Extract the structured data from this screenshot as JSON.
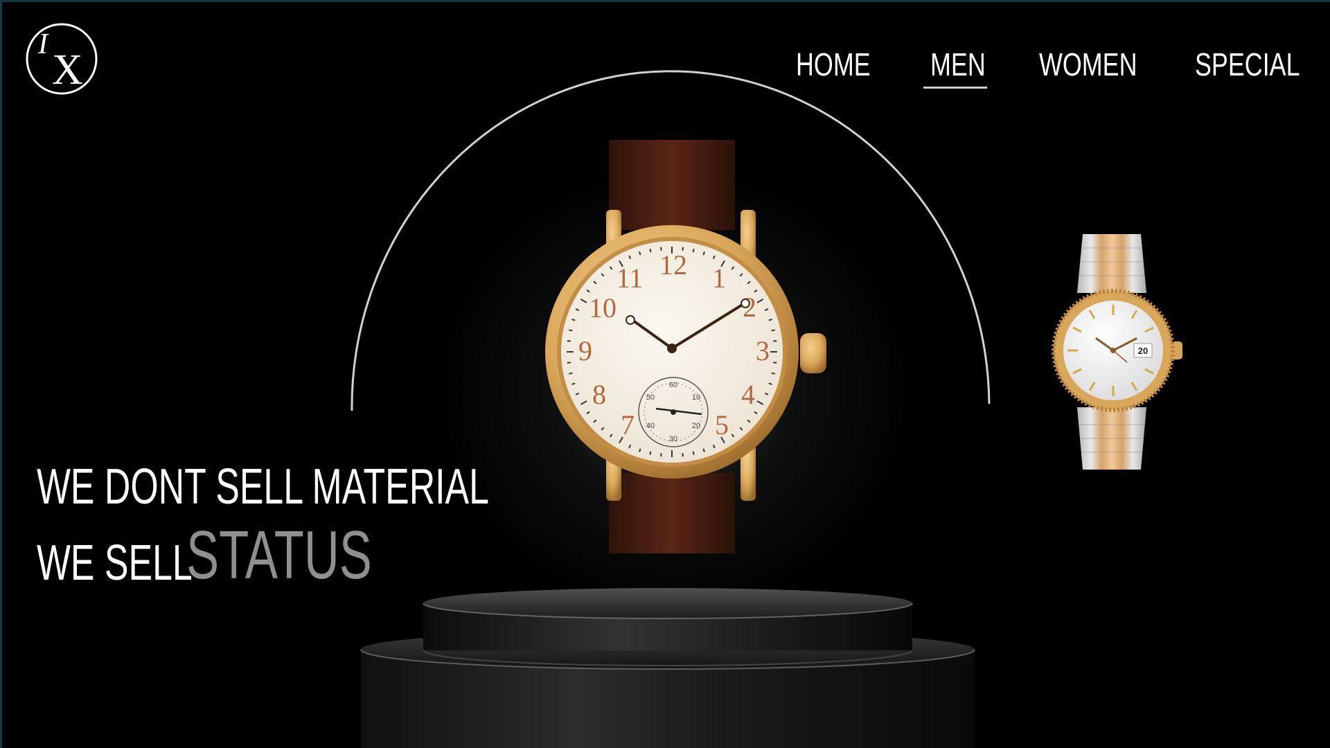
{
  "brand": {
    "logo_text_top": "I",
    "logo_text_main": "X",
    "logo_icon": "ix-monogram-logo"
  },
  "nav": {
    "items": [
      {
        "label": "HOME",
        "active": false
      },
      {
        "label": "MEN",
        "active": true
      },
      {
        "label": "WOMEN",
        "active": false
      },
      {
        "label": "SPECIAL",
        "active": false
      }
    ]
  },
  "hero": {
    "line1": "WE DONT SELL MATERIAL",
    "line2_prefix": "WE SELL",
    "line2_accent": "STATUS",
    "featured_watch": {
      "icon": "gold-leather-pocket-style-wristwatch",
      "dial_numerals": [
        "12",
        "1",
        "2",
        "3",
        "4",
        "5",
        "7",
        "8",
        "9",
        "10",
        "11"
      ],
      "subdial_numerals": [
        "60",
        "10",
        "20",
        "30",
        "40",
        "50"
      ]
    },
    "secondary_watch": {
      "icon": "two-tone-bracelet-wristwatch",
      "date": "20"
    }
  },
  "colors": {
    "background": "#000000",
    "accent_gray": "#8f8f8f",
    "gold": "#d9a75a",
    "border": "#123b42"
  }
}
